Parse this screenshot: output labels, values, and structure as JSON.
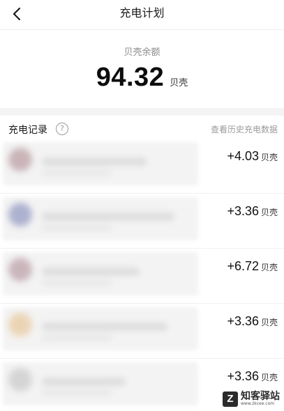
{
  "header": {
    "title": "充电计划",
    "back_icon": "chevron-left-icon"
  },
  "balance": {
    "label": "贝壳余额",
    "value": "94.32",
    "unit": "贝壳"
  },
  "records": {
    "title": "充电记录",
    "help_glyph": "?",
    "history_link": "查看历史充电数据",
    "items": [
      {
        "amount": "+4.03",
        "unit": "贝壳",
        "avatar_color": "#b89aa0"
      },
      {
        "amount": "+3.36",
        "unit": "贝壳",
        "avatar_color": "#8f96c0"
      },
      {
        "amount": "+6.72",
        "unit": "贝壳",
        "avatar_color": "#b99ca4"
      },
      {
        "amount": "+3.36",
        "unit": "贝壳",
        "avatar_color": "#e8c89a"
      },
      {
        "amount": "+3.36",
        "unit": "贝壳",
        "avatar_color": "#c8c8c8"
      }
    ]
  },
  "watermark": {
    "logo": "Z",
    "text": "知客驿站",
    "url": "www.zkcee.com"
  }
}
